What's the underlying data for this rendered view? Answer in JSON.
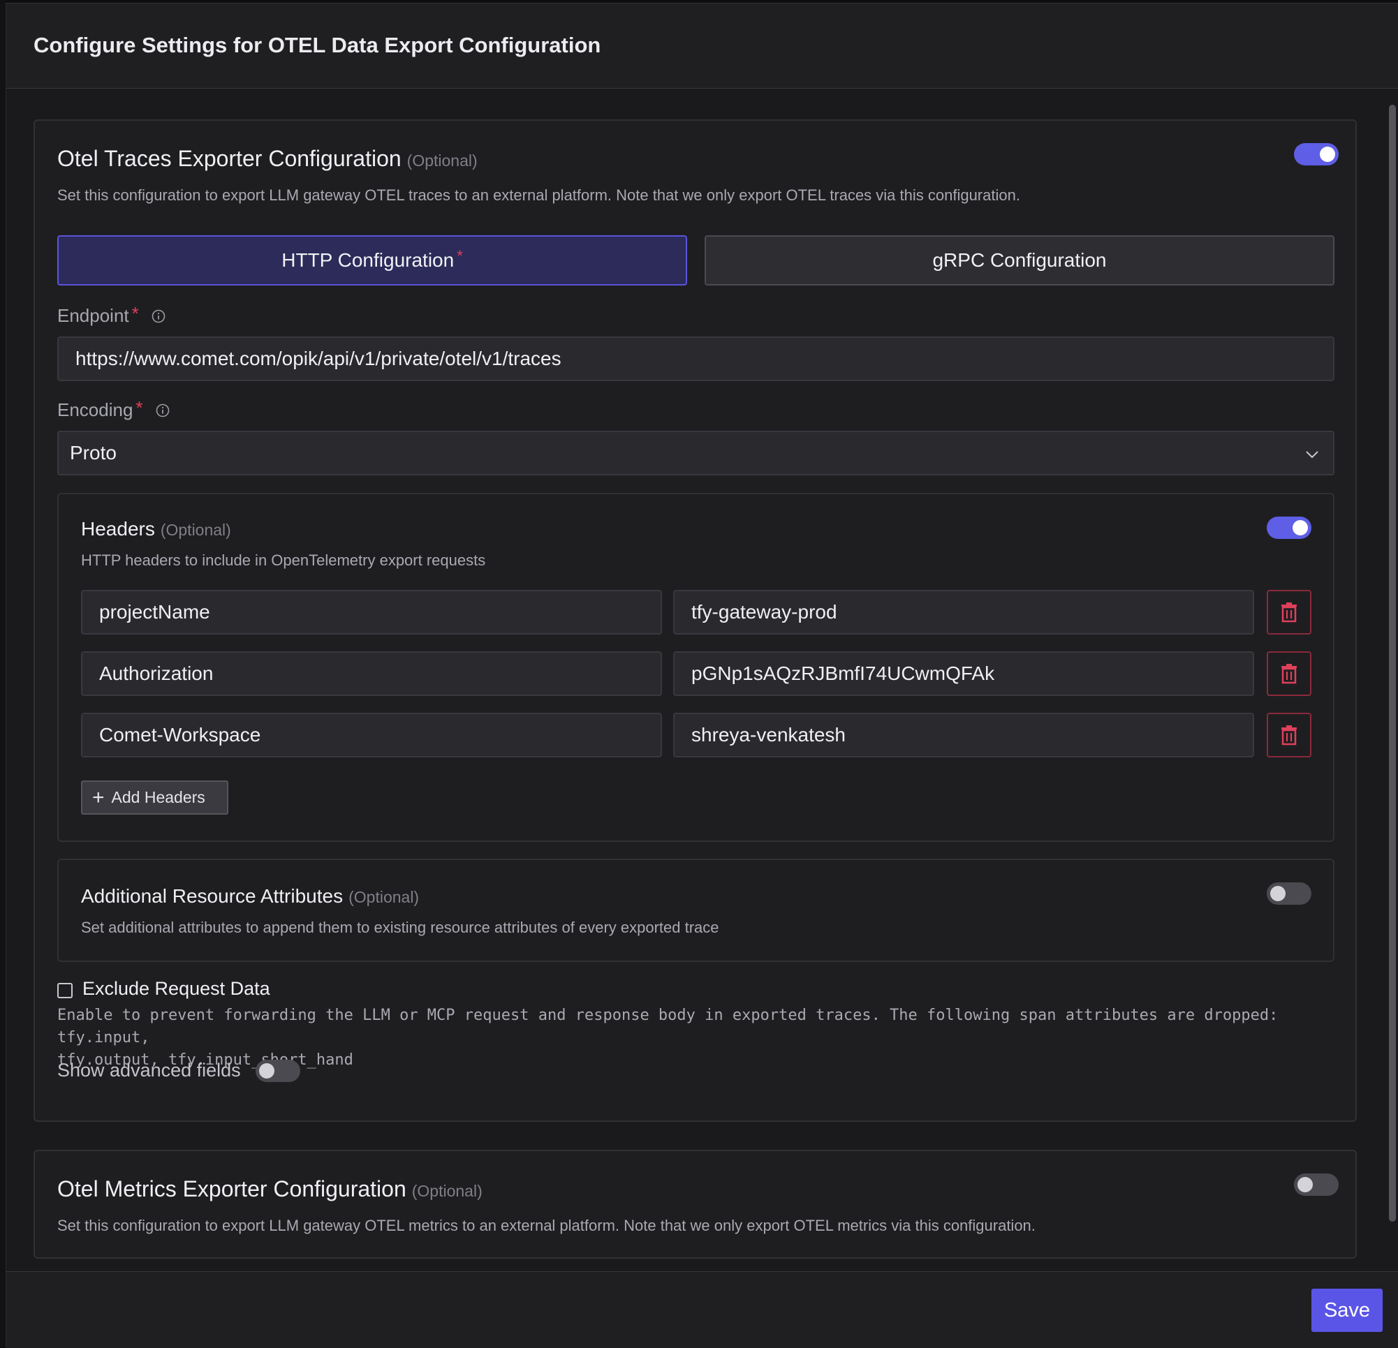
{
  "modal": {
    "title": "Configure Settings for OTEL Data Export Configuration"
  },
  "traces": {
    "title": "Otel Traces Exporter Configuration",
    "optional": "(Optional)",
    "description": "Set this configuration to export LLM gateway OTEL traces to an external platform. Note that we only export OTEL traces via this configuration.",
    "enabled": true,
    "tabs": [
      {
        "label": "HTTP Configuration",
        "required_mark": "*",
        "active": true
      },
      {
        "label": "gRPC Configuration",
        "active": false
      }
    ],
    "endpoint": {
      "label": "Endpoint",
      "required_mark": "*",
      "value": "https://www.comet.com/opik/api/v1/private/otel/v1/traces"
    },
    "encoding": {
      "label": "Encoding",
      "required_mark": "*",
      "value": "Proto"
    },
    "headers": {
      "title": "Headers",
      "optional": "(Optional)",
      "description": "HTTP headers to include in OpenTelemetry export requests",
      "enabled": true,
      "rows": [
        {
          "key": "projectName",
          "value": "tfy-gateway-prod"
        },
        {
          "key": "Authorization",
          "value": "pGNp1sAQzRJBmfI74UCwmQFAk"
        },
        {
          "key": "Comet-Workspace",
          "value": "shreya-venkatesh"
        }
      ],
      "add_label": "Add Headers"
    },
    "resource_attributes": {
      "title": "Additional Resource Attributes",
      "optional": "(Optional)",
      "description": "Set additional attributes to append them to existing resource attributes of every exported trace",
      "enabled": false
    },
    "exclude_request": {
      "label": "Exclude Request Data",
      "checked": false,
      "description_line1": "Enable to prevent forwarding the LLM or MCP request and response body in exported traces. The following span attributes are dropped: tfy.input,",
      "description_line2": "tfy.output, tfy.input_short_hand"
    },
    "advanced": {
      "label": "Show advanced fields",
      "enabled": false
    }
  },
  "metrics": {
    "title": "Otel Metrics Exporter Configuration",
    "optional": "(Optional)",
    "description": "Set this configuration to export LLM gateway OTEL metrics to an external platform. Note that we only export OTEL metrics via this configuration.",
    "enabled": false
  },
  "footer": {
    "save_label": "Save"
  },
  "colors": {
    "accent": "#5a55e6",
    "danger": "#e0405a"
  }
}
